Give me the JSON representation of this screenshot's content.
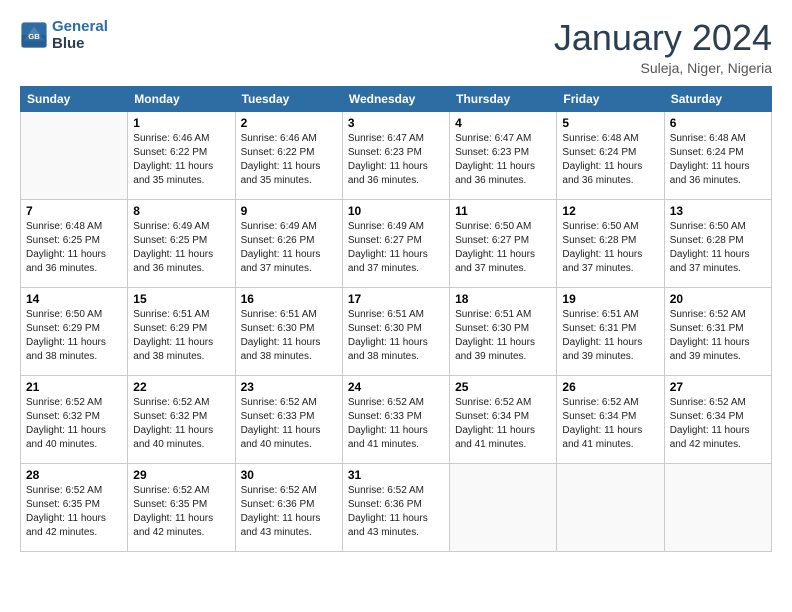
{
  "header": {
    "logo_line1": "General",
    "logo_line2": "Blue",
    "month": "January 2024",
    "location": "Suleja, Niger, Nigeria"
  },
  "weekdays": [
    "Sunday",
    "Monday",
    "Tuesday",
    "Wednesday",
    "Thursday",
    "Friday",
    "Saturday"
  ],
  "weeks": [
    [
      {
        "day": "",
        "info": ""
      },
      {
        "day": "1",
        "info": "Sunrise: 6:46 AM\nSunset: 6:22 PM\nDaylight: 11 hours\nand 35 minutes."
      },
      {
        "day": "2",
        "info": "Sunrise: 6:46 AM\nSunset: 6:22 PM\nDaylight: 11 hours\nand 35 minutes."
      },
      {
        "day": "3",
        "info": "Sunrise: 6:47 AM\nSunset: 6:23 PM\nDaylight: 11 hours\nand 36 minutes."
      },
      {
        "day": "4",
        "info": "Sunrise: 6:47 AM\nSunset: 6:23 PM\nDaylight: 11 hours\nand 36 minutes."
      },
      {
        "day": "5",
        "info": "Sunrise: 6:48 AM\nSunset: 6:24 PM\nDaylight: 11 hours\nand 36 minutes."
      },
      {
        "day": "6",
        "info": "Sunrise: 6:48 AM\nSunset: 6:24 PM\nDaylight: 11 hours\nand 36 minutes."
      }
    ],
    [
      {
        "day": "7",
        "info": "Sunrise: 6:48 AM\nSunset: 6:25 PM\nDaylight: 11 hours\nand 36 minutes."
      },
      {
        "day": "8",
        "info": "Sunrise: 6:49 AM\nSunset: 6:25 PM\nDaylight: 11 hours\nand 36 minutes."
      },
      {
        "day": "9",
        "info": "Sunrise: 6:49 AM\nSunset: 6:26 PM\nDaylight: 11 hours\nand 37 minutes."
      },
      {
        "day": "10",
        "info": "Sunrise: 6:49 AM\nSunset: 6:27 PM\nDaylight: 11 hours\nand 37 minutes."
      },
      {
        "day": "11",
        "info": "Sunrise: 6:50 AM\nSunset: 6:27 PM\nDaylight: 11 hours\nand 37 minutes."
      },
      {
        "day": "12",
        "info": "Sunrise: 6:50 AM\nSunset: 6:28 PM\nDaylight: 11 hours\nand 37 minutes."
      },
      {
        "day": "13",
        "info": "Sunrise: 6:50 AM\nSunset: 6:28 PM\nDaylight: 11 hours\nand 37 minutes."
      }
    ],
    [
      {
        "day": "14",
        "info": "Sunrise: 6:50 AM\nSunset: 6:29 PM\nDaylight: 11 hours\nand 38 minutes."
      },
      {
        "day": "15",
        "info": "Sunrise: 6:51 AM\nSunset: 6:29 PM\nDaylight: 11 hours\nand 38 minutes."
      },
      {
        "day": "16",
        "info": "Sunrise: 6:51 AM\nSunset: 6:30 PM\nDaylight: 11 hours\nand 38 minutes."
      },
      {
        "day": "17",
        "info": "Sunrise: 6:51 AM\nSunset: 6:30 PM\nDaylight: 11 hours\nand 38 minutes."
      },
      {
        "day": "18",
        "info": "Sunrise: 6:51 AM\nSunset: 6:30 PM\nDaylight: 11 hours\nand 39 minutes."
      },
      {
        "day": "19",
        "info": "Sunrise: 6:51 AM\nSunset: 6:31 PM\nDaylight: 11 hours\nand 39 minutes."
      },
      {
        "day": "20",
        "info": "Sunrise: 6:52 AM\nSunset: 6:31 PM\nDaylight: 11 hours\nand 39 minutes."
      }
    ],
    [
      {
        "day": "21",
        "info": "Sunrise: 6:52 AM\nSunset: 6:32 PM\nDaylight: 11 hours\nand 40 minutes."
      },
      {
        "day": "22",
        "info": "Sunrise: 6:52 AM\nSunset: 6:32 PM\nDaylight: 11 hours\nand 40 minutes."
      },
      {
        "day": "23",
        "info": "Sunrise: 6:52 AM\nSunset: 6:33 PM\nDaylight: 11 hours\nand 40 minutes."
      },
      {
        "day": "24",
        "info": "Sunrise: 6:52 AM\nSunset: 6:33 PM\nDaylight: 11 hours\nand 41 minutes."
      },
      {
        "day": "25",
        "info": "Sunrise: 6:52 AM\nSunset: 6:34 PM\nDaylight: 11 hours\nand 41 minutes."
      },
      {
        "day": "26",
        "info": "Sunrise: 6:52 AM\nSunset: 6:34 PM\nDaylight: 11 hours\nand 41 minutes."
      },
      {
        "day": "27",
        "info": "Sunrise: 6:52 AM\nSunset: 6:34 PM\nDaylight: 11 hours\nand 42 minutes."
      }
    ],
    [
      {
        "day": "28",
        "info": "Sunrise: 6:52 AM\nSunset: 6:35 PM\nDaylight: 11 hours\nand 42 minutes."
      },
      {
        "day": "29",
        "info": "Sunrise: 6:52 AM\nSunset: 6:35 PM\nDaylight: 11 hours\nand 42 minutes."
      },
      {
        "day": "30",
        "info": "Sunrise: 6:52 AM\nSunset: 6:36 PM\nDaylight: 11 hours\nand 43 minutes."
      },
      {
        "day": "31",
        "info": "Sunrise: 6:52 AM\nSunset: 6:36 PM\nDaylight: 11 hours\nand 43 minutes."
      },
      {
        "day": "",
        "info": ""
      },
      {
        "day": "",
        "info": ""
      },
      {
        "day": "",
        "info": ""
      }
    ]
  ]
}
